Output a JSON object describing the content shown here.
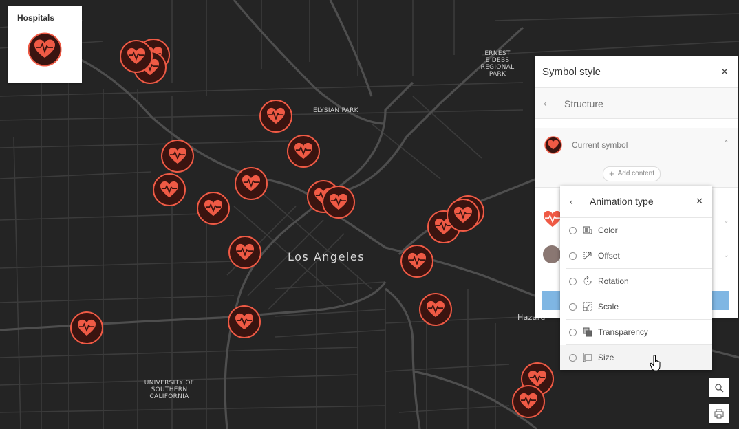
{
  "legend": {
    "title": "Hospitals",
    "symbol_icon": "heart-pulse-icon"
  },
  "map_labels": {
    "elysian_park": "ELYSIAN PARK",
    "ernest": [
      "ERNEST",
      "E DEBS",
      "REGIONAL",
      "PARK"
    ],
    "usc": [
      "UNIVERSITY OF",
      "SOUTHERN",
      "CALIFORNIA"
    ],
    "city": "Los Angeles",
    "hazard": "Hazard"
  },
  "symbol_style_panel": {
    "title": "Symbol style",
    "breadcrumb": "Structure",
    "current_symbol_label": "Current symbol",
    "add_content_label": "Add content"
  },
  "animation_popover": {
    "title": "Animation type",
    "options": [
      {
        "label": "Color",
        "icon": "color-icon"
      },
      {
        "label": "Offset",
        "icon": "offset-icon"
      },
      {
        "label": "Rotation",
        "icon": "rotation-icon"
      },
      {
        "label": "Scale",
        "icon": "scale-icon"
      },
      {
        "label": "Transparency",
        "icon": "transparency-icon"
      },
      {
        "label": "Size",
        "icon": "size-icon"
      }
    ],
    "hovered_option": "Size"
  },
  "colors": {
    "marker_fill": "#3a1410",
    "marker_stroke": "#ef5a45",
    "heart": "#ef5a45",
    "accent_blue": "#7fb6e3"
  }
}
